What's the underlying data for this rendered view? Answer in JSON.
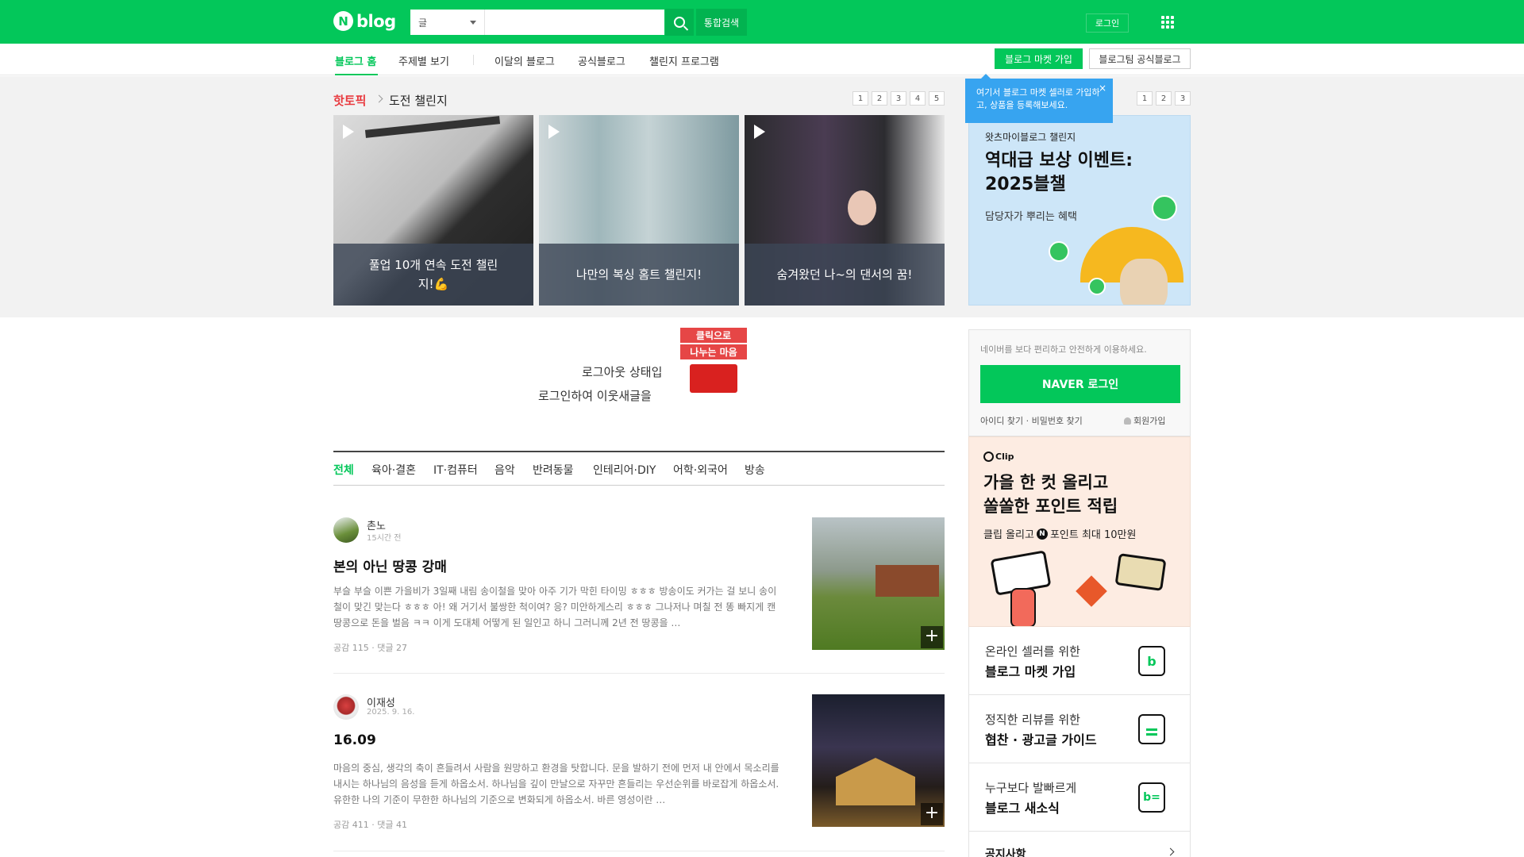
{
  "header": {
    "logo_text": "blog",
    "search_type": "글",
    "search_placeholder": "",
    "search_value": "",
    "all_search_label": "통합검색",
    "login_label": "로그인"
  },
  "nav": {
    "items": [
      "블로그 홈",
      "주제별 보기",
      "이달의 블로그",
      "공식블로그",
      "챌린지 프로그램"
    ],
    "market_button": "블로그 마켓 가입",
    "official_button": "블로그팀 공식블로그"
  },
  "hot_topic": {
    "label": "핫토픽",
    "title": "도전 챌린지",
    "pages": [
      "1",
      "2",
      "3",
      "4",
      "5"
    ],
    "cards": [
      {
        "caption": "풀업 10개 연속 도전 챌린지!💪"
      },
      {
        "caption": "나만의 복싱 홈트 챌린지!"
      },
      {
        "caption": "숨겨왔던 나~의 댄서의 꿈!"
      }
    ]
  },
  "promo": {
    "pages": [
      "1",
      "2",
      "3"
    ],
    "tooltip": "여기서 블로그 마켓 셀러로 가입하고, 상품을 등록해보세요.",
    "tooltip_close": "×",
    "subtitle": "왓츠마이블로그 챌린지",
    "title": "역대급 보상 이벤트: 2025블챌",
    "desc": "담당자가 뿌리는 혜택"
  },
  "logout_notice": {
    "line1": "로그아웃 상태입",
    "line2": "로그인하여 이웃새글을 ",
    "gift_tag1": "클릭으로",
    "gift_tag2": "나누는 마음"
  },
  "categories": [
    "전체",
    "육아·결혼",
    "IT·컴퓨터",
    "음악",
    "반려동물",
    "인테리어·DIY",
    "어학·외국어",
    "방송"
  ],
  "posts": [
    {
      "author": "촌노",
      "time": "15시간 전",
      "title": "본의 아닌 땅콩 강매",
      "body": "부슬 부슬 이쁜 가을비가 3일째 내림 송이철을 맞아 아주 기가 막힌 타이밍 ㅎㅎㅎ 방송이도 커가는 걸 보니 송이철이 맞긴 맞는다 ㅎㅎㅎ 아! 왜 거기서 불쌍한 척이여? 응? 미안하게스리 ㅎㅎㅎ 그나저나 며칠 전 똥 빠지게 캔 땅콩으로 돈을 벌음 ㅋㅋ 이게 도대체 어떻게 된 일인고 하니 그러니께 2년 전 땅콩을 …",
      "meta": "공감 115 · 댓글 27"
    },
    {
      "author": "이재성",
      "time": "2025. 9. 16.",
      "title": "16.09",
      "body": "마음의 중심, 생각의 축이 흔들려서 사람을 원망하고 환경을 탓합니다. 문을 발하기 전에 먼저 내 안에서 목소리를 내시는 하나님의 음성을 듣게 하옵소서. 하나님을 깊이 만날으로 자꾸만 흔들리는 우선순위를 바로잡게 하옵소서. 유한한 나의 기준이 무한한 하나님의 기준으로 변화되게 하옵소서. 바른 영성이란 …",
      "meta": "공감 411 · 댓글 41"
    }
  ],
  "login_box": {
    "text": "네이버를 보다 편리하고 안전하게 이용하세요.",
    "naver_button": "NAVER 로그인",
    "links": "아이디 찾기 · 비밀번호 찾기",
    "join": "회원가입"
  },
  "clip_ad": {
    "logo": "Clip",
    "title_line1": "가을 한 컷 올리고",
    "title_line2": "쏠쏠한 포인트 적립",
    "desc_pre": "클립 올리고",
    "desc_post": "포인트 최대 10만원"
  },
  "side_items": [
    {
      "line1": "온라인 셀러를 위한",
      "line2": "블로그 마켓 가입"
    },
    {
      "line1": "정직한 리뷰를 위한",
      "line2": "협찬 · 광고글 가이드"
    },
    {
      "line1": "누구보다 발빠르게",
      "line2": "블로그 새소식"
    }
  ],
  "notice_label": "공지사항"
}
